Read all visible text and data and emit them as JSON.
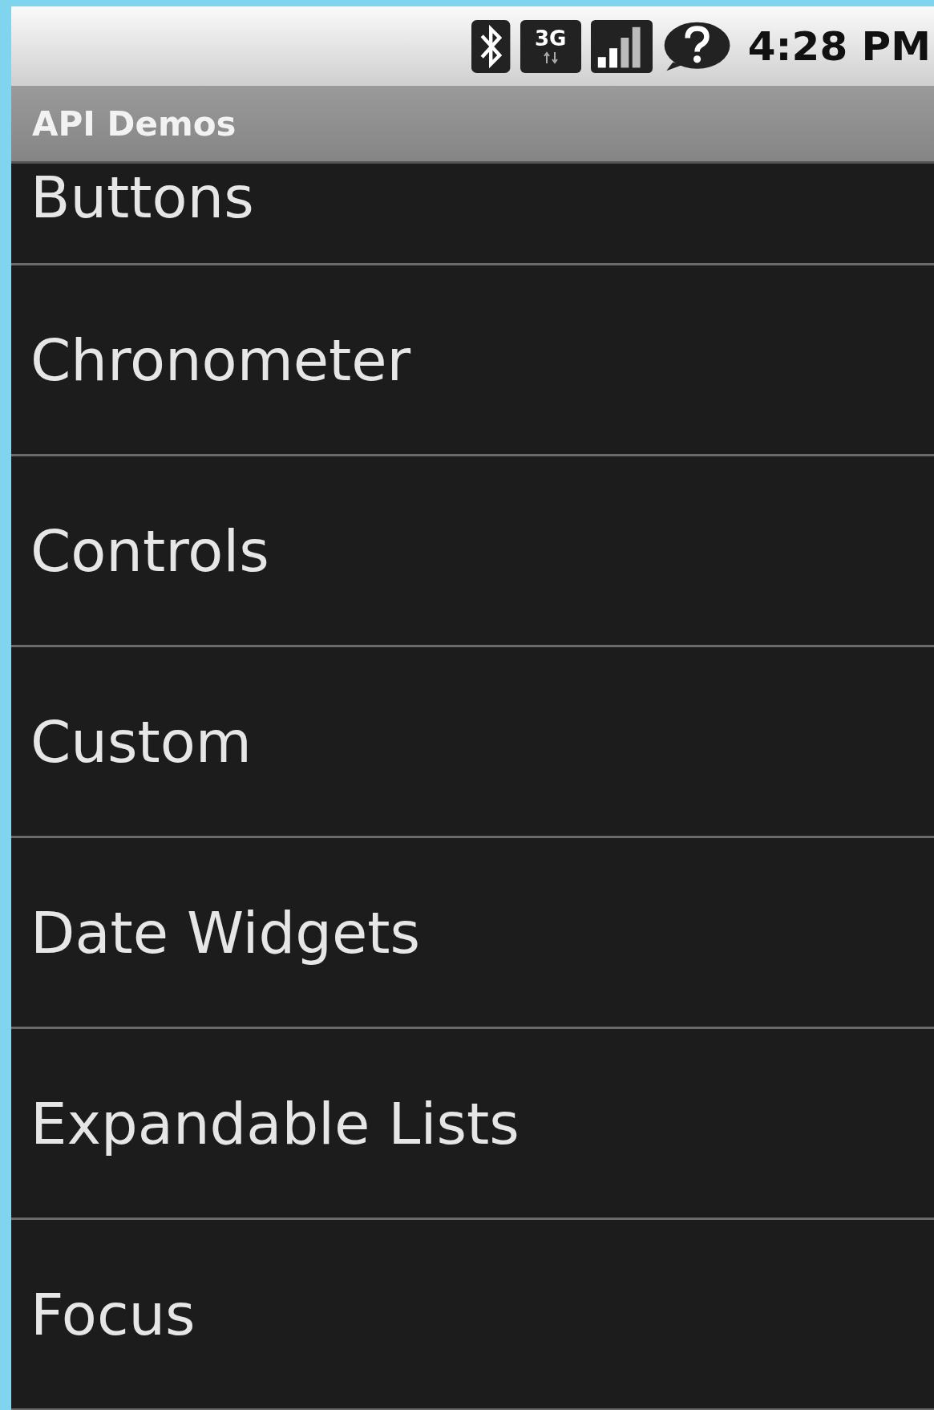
{
  "status_bar": {
    "time": "4:28 PM",
    "network": "3G"
  },
  "title_bar": {
    "title": "API Demos"
  },
  "list": {
    "items": [
      {
        "label": "Buttons"
      },
      {
        "label": "Chronometer"
      },
      {
        "label": "Controls"
      },
      {
        "label": "Custom"
      },
      {
        "label": "Date Widgets"
      },
      {
        "label": "Expandable Lists"
      },
      {
        "label": "Focus"
      }
    ]
  }
}
